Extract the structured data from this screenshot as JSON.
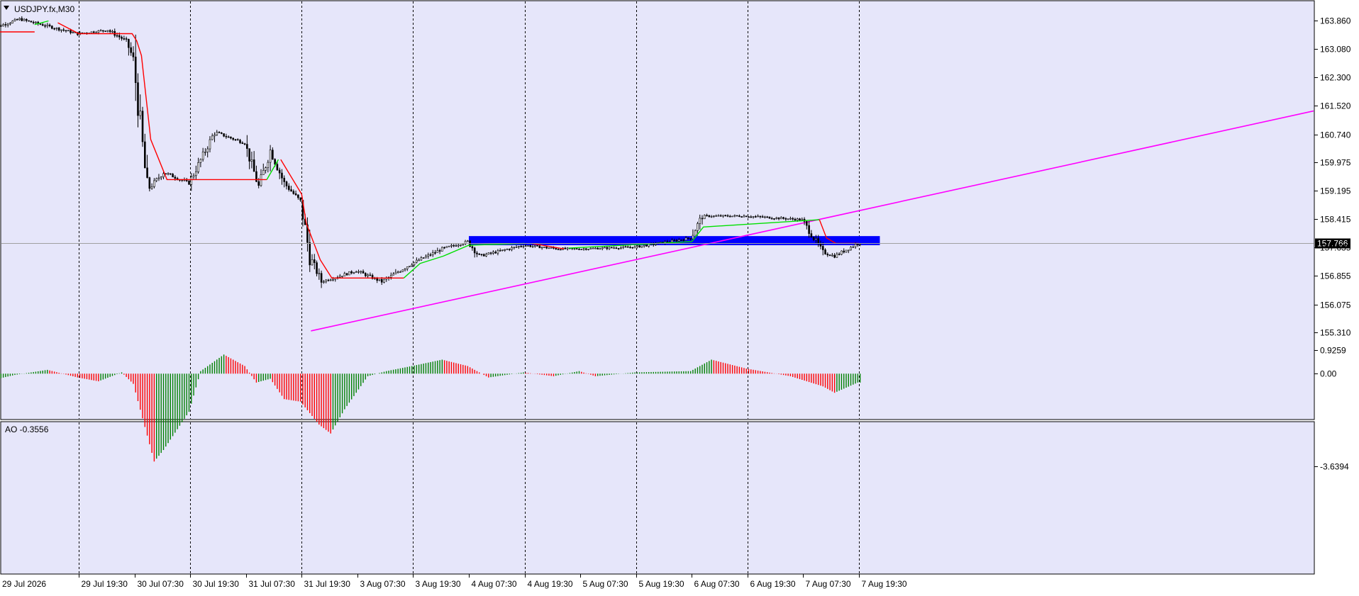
{
  "symbol_header": {
    "title": "USDJPY.fx,M30",
    "dropdown_icon": "triangle-down-icon"
  },
  "chart_data": [
    {
      "type": "candlestick",
      "symbol": "USDJPY.fx",
      "timeframe": "M30",
      "ylim": [
        155.0,
        164.3
      ],
      "y_ticks": [
        "163.860",
        "163.080",
        "162.300",
        "161.520",
        "160.740",
        "159.975",
        "159.195",
        "158.415",
        "157.635",
        "156.855",
        "156.075",
        "155.310"
      ],
      "x_ticks": [
        "29 Jul 2026",
        "29 Jul 19:30",
        "30 Jul 07:30",
        "30 Jul 19:30",
        "31 Jul 07:30",
        "31 Jul 19:30",
        "3 Aug 07:30",
        "3 Aug 19:30",
        "4 Aug 07:30",
        "4 Aug 19:30",
        "5 Aug 07:30",
        "5 Aug 19:30",
        "6 Aug 07:30",
        "6 Aug 19:30",
        "7 Aug 07:30",
        "7 Aug 19:30"
      ],
      "period_separators": [
        "29 Jul 19:30",
        "30 Jul 19:30",
        "31 Jul 19:30",
        "3 Aug 19:30",
        "4 Aug 19:30",
        "5 Aug 19:30",
        "6 Aug 19:30",
        "7 Aug 19:30"
      ],
      "current_price": {
        "label": "157.766",
        "value": 157.766
      },
      "price_path": [
        {
          "t": "29 Jul 2026",
          "price": 163.6
        },
        {
          "t": "29 Jul 07:00",
          "price": 163.9
        },
        {
          "t": "29 Jul 19:30",
          "price": 163.5
        },
        {
          "t": "30 Jul 02:00",
          "price": 163.6
        },
        {
          "t": "30 Jul 06:00",
          "price": 163.3
        },
        {
          "t": "30 Jul 07:30",
          "price": 162.8
        },
        {
          "t": "30 Jul 10:30",
          "price": 159.2
        },
        {
          "t": "30 Jul 14:00",
          "price": 159.7
        },
        {
          "t": "30 Jul 19:30",
          "price": 159.4
        },
        {
          "t": "31 Jul 01:00",
          "price": 160.8
        },
        {
          "t": "31 Jul 07:30",
          "price": 160.5
        },
        {
          "t": "31 Jul 10:30",
          "price": 159.3
        },
        {
          "t": "31 Jul 13:00",
          "price": 160.3
        },
        {
          "t": "31 Jul 16:00",
          "price": 159.4
        },
        {
          "t": "31 Jul 19:30",
          "price": 158.9
        },
        {
          "t": "31 Jul 21:30",
          "price": 157.4
        },
        {
          "t": "3 Aug 00:00",
          "price": 156.7
        },
        {
          "t": "3 Aug 07:30",
          "price": 157.0
        },
        {
          "t": "3 Aug 13:00",
          "price": 156.7
        },
        {
          "t": "3 Aug 19:30",
          "price": 157.2
        },
        {
          "t": "4 Aug 02:00",
          "price": 157.6
        },
        {
          "t": "4 Aug 07:30",
          "price": 157.8
        },
        {
          "t": "4 Aug 10:00",
          "price": 157.4
        },
        {
          "t": "4 Aug 19:30",
          "price": 157.7
        },
        {
          "t": "5 Aug 03:00",
          "price": 157.6
        },
        {
          "t": "5 Aug 07:30",
          "price": 157.6
        },
        {
          "t": "5 Aug 19:30",
          "price": 157.65
        },
        {
          "t": "6 Aug 03:00",
          "price": 157.8
        },
        {
          "t": "6 Aug 07:30",
          "price": 157.9
        },
        {
          "t": "6 Aug 10:00",
          "price": 158.5
        },
        {
          "t": "6 Aug 19:30",
          "price": 158.5
        },
        {
          "t": "7 Aug 07:30",
          "price": 158.4
        },
        {
          "t": "7 Aug 12:00",
          "price": 157.5
        },
        {
          "t": "7 Aug 14:30",
          "price": 157.4
        },
        {
          "t": "7 Aug 19:30",
          "price": 157.75
        }
      ],
      "trailing_stop": {
        "up_color": "#00e000",
        "down_color": "#ff0000",
        "segments": [
          {
            "color": "down",
            "points": [
              [
                "29 Jul 2026",
                163.55
              ],
              [
                "29 Jul 10:00",
                163.55
              ]
            ]
          },
          {
            "color": "up",
            "points": [
              [
                "29 Jul 10:00",
                163.75
              ],
              [
                "29 Jul 13:00",
                163.85
              ]
            ]
          },
          {
            "color": "down",
            "points": [
              [
                "29 Jul 15:00",
                163.8
              ],
              [
                "29 Jul 19:30",
                163.5
              ],
              [
                "30 Jul 07:00",
                163.5
              ],
              [
                "30 Jul 08:00",
                163.3
              ],
              [
                "30 Jul 09:00",
                162.9
              ],
              [
                "30 Jul 11:00",
                160.6
              ],
              [
                "30 Jul 14:30",
                159.5
              ],
              [
                "31 Jul 12:00",
                159.5
              ]
            ]
          },
          {
            "color": "up",
            "points": [
              [
                "31 Jul 12:00",
                159.5
              ],
              [
                "31 Jul 14:30",
                160.05
              ]
            ]
          },
          {
            "color": "down",
            "points": [
              [
                "31 Jul 15:00",
                160.05
              ],
              [
                "31 Jul 19:30",
                159.1
              ],
              [
                "31 Jul 20:30",
                158.3
              ],
              [
                "31 Jul 23:30",
                157.3
              ],
              [
                "3 Aug 02:00",
                156.8
              ],
              [
                "3 Aug 17:30",
                156.8
              ]
            ]
          },
          {
            "color": "up",
            "points": [
              [
                "3 Aug 17:30",
                156.8
              ],
              [
                "3 Aug 21:00",
                157.2
              ],
              [
                "4 Aug 02:00",
                157.4
              ],
              [
                "4 Aug 07:30",
                157.7
              ],
              [
                "4 Aug 19:30",
                157.75
              ]
            ]
          },
          {
            "color": "down",
            "points": [
              [
                "4 Aug 21:00",
                157.75
              ],
              [
                "5 Aug 04:00",
                157.6
              ]
            ]
          },
          {
            "color": "up",
            "points": [
              [
                "5 Aug 05:00",
                157.62
              ],
              [
                "6 Aug 07:30",
                157.8
              ],
              [
                "6 Aug 10:00",
                158.2
              ],
              [
                "7 Aug 11:00",
                158.4
              ]
            ]
          },
          {
            "color": "down",
            "points": [
              [
                "7 Aug 11:00",
                158.4
              ],
              [
                "7 Aug 12:30",
                157.9
              ],
              [
                "7 Aug 14:30",
                157.75
              ],
              [
                "7 Aug 19:30",
                157.75
              ]
            ]
          }
        ]
      },
      "trendline": {
        "color": "#ff00ff",
        "from": [
          "31 Jul 21:30",
          155.35
        ],
        "through": [
          "6 Aug 15:00",
          157.85
        ]
      },
      "zone": {
        "color": "#0000ff",
        "from": "4 Aug 07:30",
        "to": "9 Aug 08:00",
        "top": 157.95,
        "bottom": 157.7
      }
    },
    {
      "type": "histogram",
      "indicator": "AO",
      "label": "AO -0.3556",
      "ylim": [
        -3.6394,
        0.9259
      ],
      "y_ticks": [
        "0.9259",
        "0.00",
        "-3.6394"
      ],
      "up_color": "#008000",
      "down_color": "#ff0000",
      "bar_width_hours": 0.5,
      "values": [
        {
          "t": "29 Jul 2026",
          "v": -0.3
        },
        {
          "t": "29 Jul 06:00",
          "v": -0.05
        },
        {
          "t": "29 Jul 13:00",
          "v": 0.15
        },
        {
          "t": "29 Jul 19:30",
          "v": -0.15
        },
        {
          "t": "30 Jul 00:00",
          "v": -0.3
        },
        {
          "t": "30 Jul 05:00",
          "v": 0.05
        },
        {
          "t": "30 Jul 07:30",
          "v": -0.4
        },
        {
          "t": "30 Jul 12:00",
          "v": -3.45
        },
        {
          "t": "30 Jul 14:00",
          "v": -3.0
        },
        {
          "t": "30 Jul 19:30",
          "v": -1.5
        },
        {
          "t": "30 Jul 22:00",
          "v": 0.1
        },
        {
          "t": "31 Jul 03:00",
          "v": 0.75
        },
        {
          "t": "31 Jul 07:30",
          "v": 0.3
        },
        {
          "t": "31 Jul 10:00",
          "v": -0.35
        },
        {
          "t": "31 Jul 13:00",
          "v": -0.2
        },
        {
          "t": "31 Jul 16:00",
          "v": -1.0
        },
        {
          "t": "31 Jul 19:30",
          "v": -1.1
        },
        {
          "t": "31 Jul 23:30",
          "v": -2.0
        },
        {
          "t": "3 Aug 02:00",
          "v": -2.35
        },
        {
          "t": "3 Aug 05:00",
          "v": -1.4
        },
        {
          "t": "3 Aug 10:00",
          "v": -0.1
        },
        {
          "t": "3 Aug 14:00",
          "v": 0.1
        },
        {
          "t": "3 Aug 19:30",
          "v": 0.3
        },
        {
          "t": "4 Aug 02:00",
          "v": 0.55
        },
        {
          "t": "4 Aug 07:30",
          "v": 0.3
        },
        {
          "t": "4 Aug 12:00",
          "v": -0.15
        },
        {
          "t": "4 Aug 19:30",
          "v": 0.05
        },
        {
          "t": "5 Aug 02:00",
          "v": -0.1
        },
        {
          "t": "5 Aug 07:30",
          "v": 0.1
        },
        {
          "t": "5 Aug 11:00",
          "v": -0.1
        },
        {
          "t": "5 Aug 19:30",
          "v": 0.05
        },
        {
          "t": "6 Aug 07:30",
          "v": 0.1
        },
        {
          "t": "6 Aug 12:00",
          "v": 0.55
        },
        {
          "t": "6 Aug 19:30",
          "v": 0.2
        },
        {
          "t": "7 Aug 05:00",
          "v": -0.1
        },
        {
          "t": "7 Aug 12:00",
          "v": -0.5
        },
        {
          "t": "7 Aug 14:30",
          "v": -0.75
        },
        {
          "t": "7 Aug 19:30",
          "v": -0.35
        }
      ]
    }
  ]
}
